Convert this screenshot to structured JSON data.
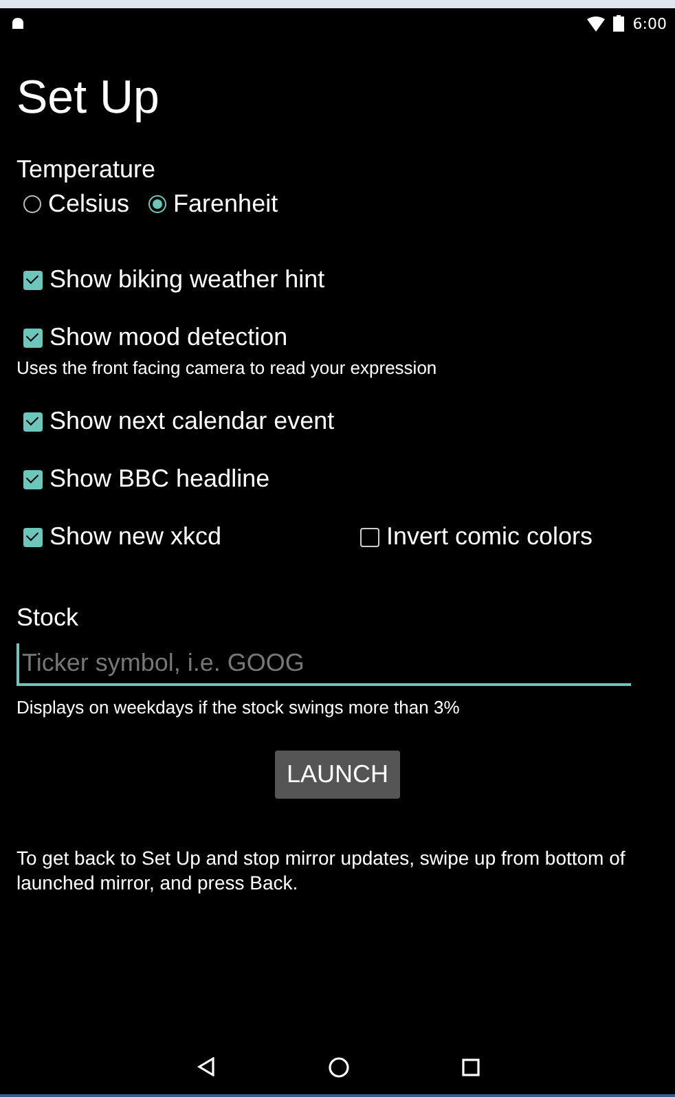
{
  "status_bar": {
    "time": "6:00"
  },
  "title": "Set Up",
  "temperature": {
    "label": "Temperature",
    "options": [
      {
        "label": "Celsius",
        "selected": false
      },
      {
        "label": "Farenheit",
        "selected": true
      }
    ]
  },
  "option_rows": [
    {
      "checkboxes": [
        {
          "label": "Show biking weather hint",
          "checked": true
        }
      ]
    },
    {
      "checkboxes": [
        {
          "label": "Show mood detection",
          "checked": true
        }
      ],
      "hint": "Uses the front facing camera to read your expression"
    },
    {
      "checkboxes": [
        {
          "label": "Show next calendar event",
          "checked": true
        }
      ]
    },
    {
      "checkboxes": [
        {
          "label": "Show BBC headline",
          "checked": true
        }
      ]
    },
    {
      "checkboxes": [
        {
          "label": "Show new xkcd",
          "checked": true
        },
        {
          "label": "Invert comic colors",
          "checked": false
        }
      ]
    }
  ],
  "stock": {
    "label": "Stock",
    "placeholder": "Ticker symbol, i.e. GOOG",
    "hint": "Displays on weekdays if the stock swings more than 3%"
  },
  "launch_button": "LAUNCH",
  "footer_note": "To get back to Set Up and stop mirror updates, swipe up from bottom of launched mirror, and press Back."
}
